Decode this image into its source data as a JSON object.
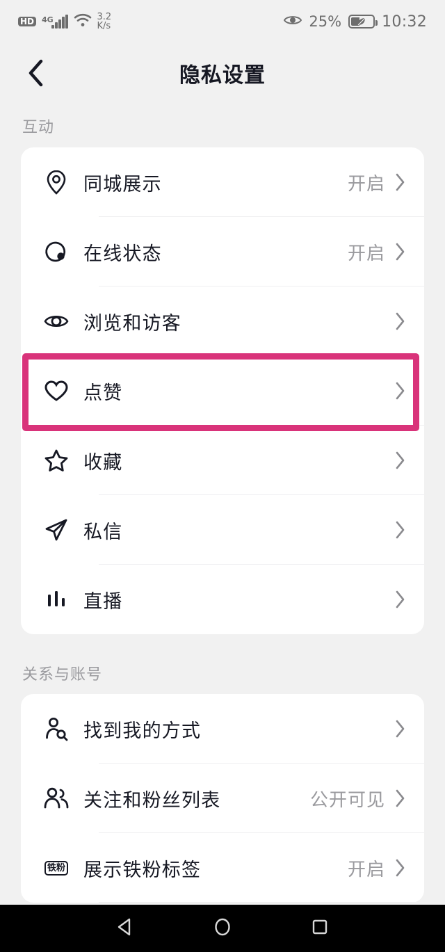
{
  "statusbar": {
    "hd_label": "HD",
    "network_type": "4G",
    "net_speed_value": "3.2",
    "net_speed_unit": "K/s",
    "battery_percent": "25%",
    "clock": "10:32",
    "icons": [
      "hd-icon",
      "signal-icon",
      "wifi-icon",
      "eye-comfort-icon",
      "battery-icon"
    ]
  },
  "header": {
    "back_label": "",
    "title": "隐私设置"
  },
  "sections": [
    {
      "label": "互动",
      "items": [
        {
          "icon": "location-pin-icon",
          "label": "同城展示",
          "value": "开启"
        },
        {
          "icon": "online-status-icon",
          "label": "在线状态",
          "value": "开启"
        },
        {
          "icon": "eye-icon",
          "label": "浏览和访客",
          "value": ""
        },
        {
          "icon": "heart-icon",
          "label": "点赞",
          "value": ""
        },
        {
          "icon": "star-icon",
          "label": "收藏",
          "value": ""
        },
        {
          "icon": "paper-plane-icon",
          "label": "私信",
          "value": ""
        },
        {
          "icon": "live-bars-icon",
          "label": "直播",
          "value": ""
        }
      ]
    },
    {
      "label": "关系与账号",
      "items": [
        {
          "icon": "person-search-icon",
          "label": "找到我的方式",
          "value": ""
        },
        {
          "icon": "people-icon",
          "label": "关注和粉丝列表",
          "value": "公开可见"
        },
        {
          "icon": "tiefen-badge-icon",
          "label": "展示铁粉标签",
          "value": "开启",
          "badge_text": "铁粉"
        }
      ]
    }
  ],
  "highlight": {
    "target_label": "点赞",
    "color": "#d9337a"
  },
  "navbar": {
    "buttons": [
      "back-triangle-icon",
      "home-circle-icon",
      "recents-square-icon"
    ]
  },
  "colors": {
    "background": "#f1f1f1",
    "card": "#ffffff",
    "text_primary": "#161823",
    "text_secondary": "#9a9a9e",
    "accent": "#d9337a"
  }
}
